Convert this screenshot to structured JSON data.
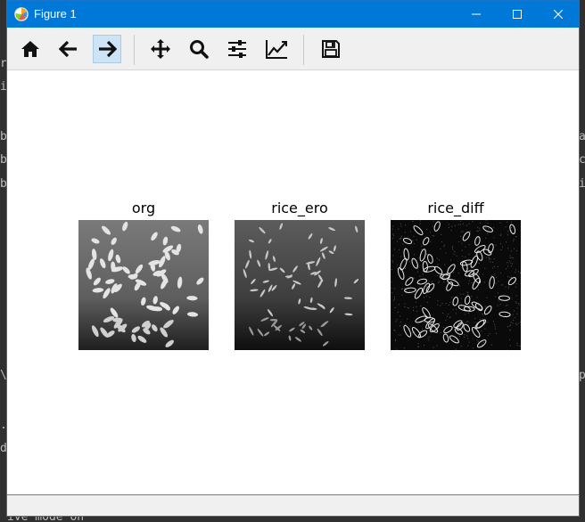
{
  "window": {
    "title": "Figure 1"
  },
  "toolbar": {
    "buttons": [
      {
        "name": "home-button",
        "icon": "home-icon"
      },
      {
        "name": "back-button",
        "icon": "arrow-left-icon"
      },
      {
        "name": "forward-button",
        "icon": "arrow-right-icon",
        "active": true
      },
      {
        "name": "pan-button",
        "icon": "move-icon"
      },
      {
        "name": "zoom-button",
        "icon": "magnifier-icon"
      },
      {
        "name": "configure-subplots-button",
        "icon": "sliders-icon"
      },
      {
        "name": "edit-axis-button",
        "icon": "line-chart-icon"
      },
      {
        "name": "save-button",
        "icon": "floppy-disk-icon"
      }
    ]
  },
  "figure": {
    "subplots": [
      {
        "title": "org"
      },
      {
        "title": "rice_ero"
      },
      {
        "title": "rice_diff"
      }
    ]
  },
  "background_terminal": {
    "left_chars": [
      "r",
      "i",
      "b",
      "b",
      "b",
      "\\",
      ".",
      "d"
    ],
    "right_chars": [
      "a",
      "c",
      "i",
      "p"
    ],
    "bottom_text": "ive mode on"
  },
  "colors": {
    "titlebar": "#0078d7",
    "toolbar": "#f0f0f0",
    "active_button": "#cde4f7"
  }
}
